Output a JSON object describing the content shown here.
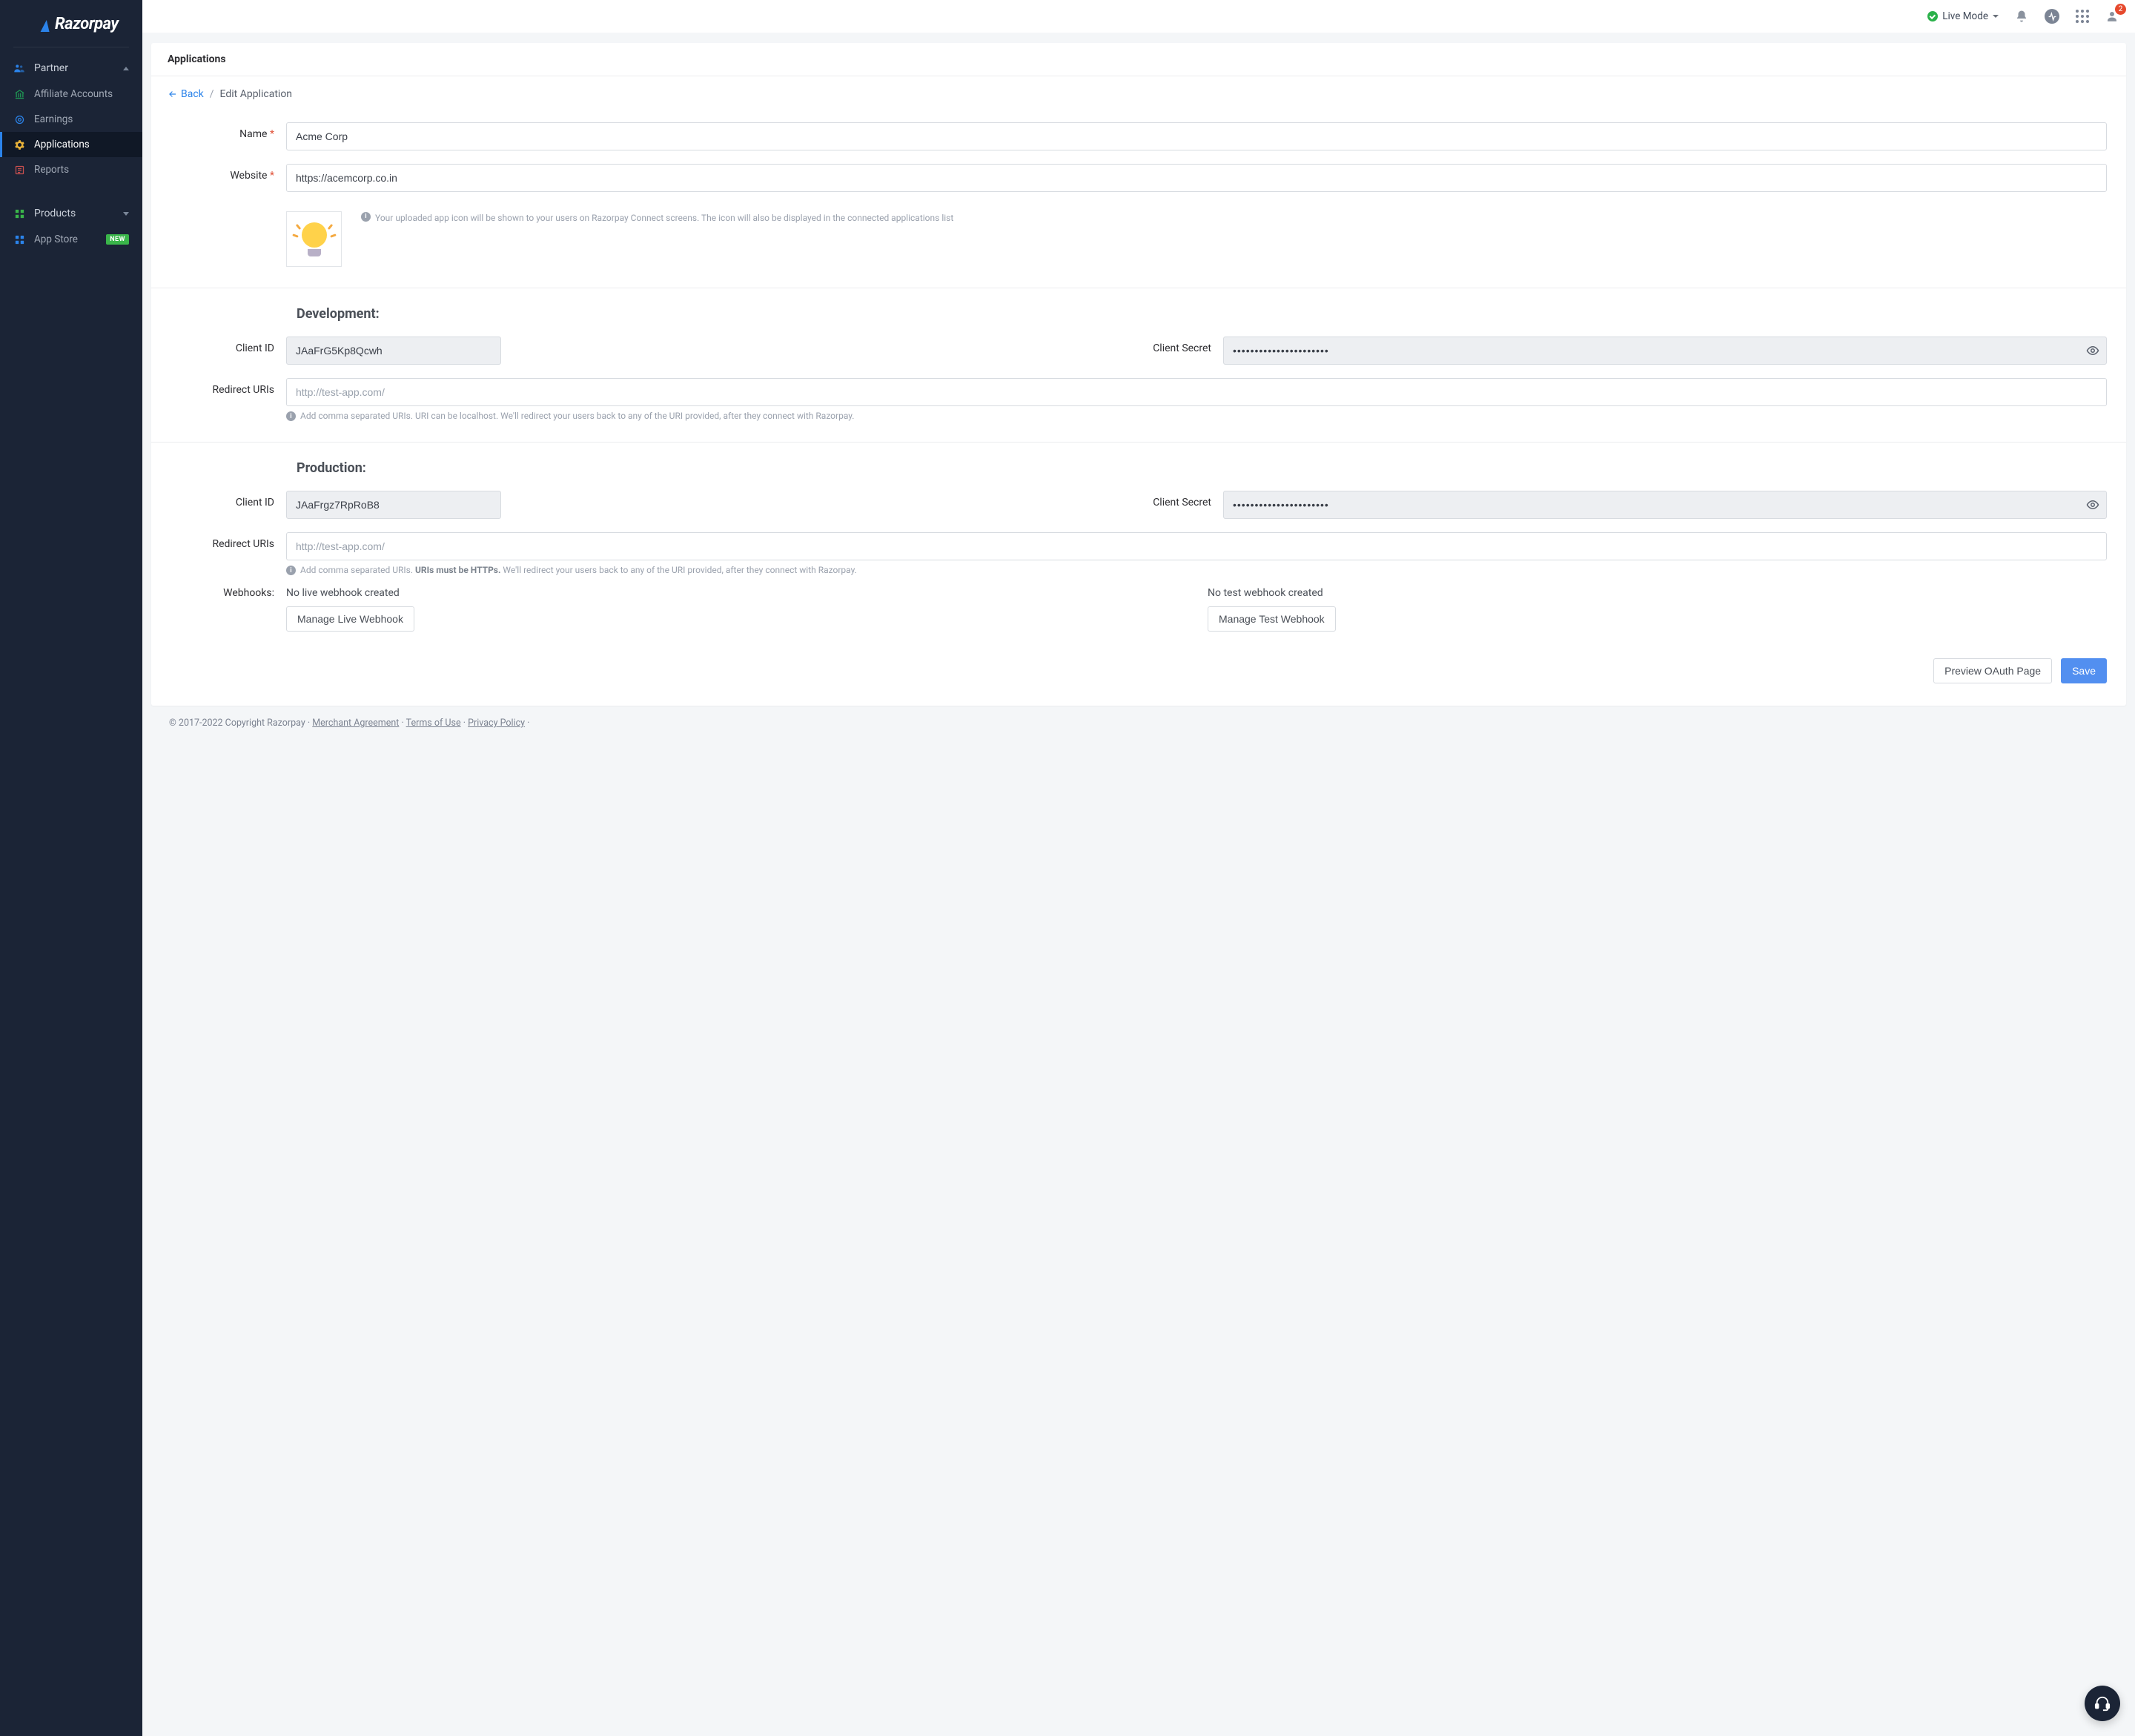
{
  "brand": "Razorpay",
  "sidebar": {
    "partner": {
      "label": "Partner",
      "items": [
        {
          "label": "Affiliate Accounts",
          "icon": "bank-icon"
        },
        {
          "label": "Earnings",
          "icon": "target-icon"
        },
        {
          "label": "Applications",
          "icon": "gear-icon",
          "active": true
        },
        {
          "label": "Reports",
          "icon": "report-icon"
        }
      ]
    },
    "products": {
      "label": "Products",
      "items": [
        {
          "label": "App Store",
          "icon": "apps-icon",
          "badge": "NEW"
        }
      ]
    }
  },
  "topbar": {
    "mode": "Live Mode",
    "notification_count": "2"
  },
  "page": {
    "title": "Applications",
    "breadcrumb": {
      "back": "Back",
      "current": "Edit Application"
    },
    "form": {
      "name_label": "Name",
      "name_value": "Acme Corp",
      "website_label": "Website",
      "website_value": "https://acemcorp.co.in",
      "icon_hint": "Your uploaded app icon will be shown to your users on Razorpay Connect screens. The icon will also be displayed in the connected applications list",
      "dev": {
        "title": "Development:",
        "client_id_label": "Client ID",
        "client_id_value": "JAaFrG5Kp8Qcwh",
        "client_secret_label": "Client Secret",
        "client_secret_value": "••••••••••••••••••••••",
        "redirect_label": "Redirect URIs",
        "redirect_placeholder": "http://test-app.com/",
        "redirect_hint": "Add comma separated URIs. URI can be localhost. We'll redirect your users back to any of the URI provided, after they connect with Razorpay."
      },
      "prod": {
        "title": "Production:",
        "client_id_label": "Client ID",
        "client_id_value": "JAaFrgz7RpRoB8",
        "client_secret_label": "Client Secret",
        "client_secret_value": "••••••••••••••••••••••",
        "redirect_label": "Redirect URIs",
        "redirect_placeholder": "http://test-app.com/",
        "redirect_hint_pre": "Add comma separated URIs. ",
        "redirect_hint_bold": "URIs must be HTTPs.",
        "redirect_hint_post": " We'll redirect your users back to any of the URI provided, after they connect with Razorpay."
      },
      "webhooks": {
        "label": "Webhooks:",
        "live_status": "No live webhook created",
        "live_button": "Manage Live Webhook",
        "test_status": "No test webhook created",
        "test_button": "Manage Test Webhook"
      },
      "actions": {
        "preview": "Preview OAuth Page",
        "save": "Save"
      }
    }
  },
  "footer": {
    "copyright": "© 2017-2022 Copyright Razorpay · ",
    "links": {
      "merchant": "Merchant Agreement",
      "terms": "Terms of Use",
      "privacy": "Privacy Policy"
    }
  }
}
